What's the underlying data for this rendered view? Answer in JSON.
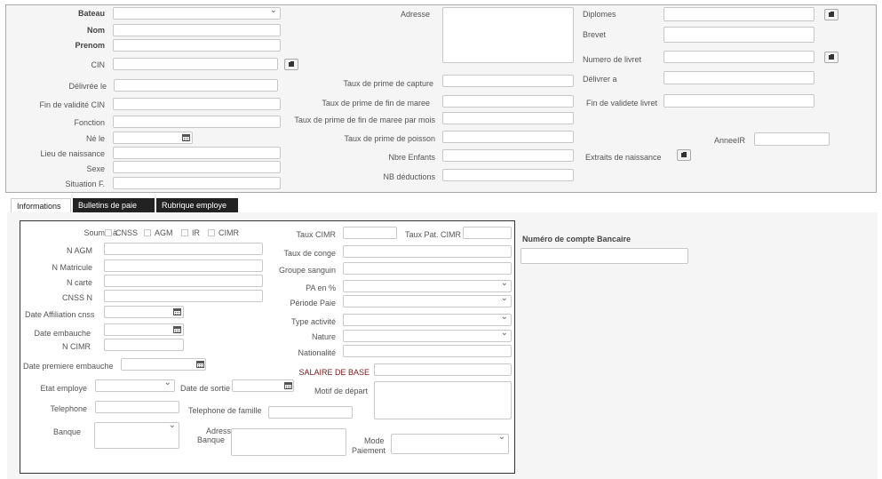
{
  "top": {
    "bateau": "Bateau",
    "nom": "Nom",
    "prenom": "Prenom",
    "cin": "CIN",
    "delivree_le": "Délivrée le",
    "fin_validite_cin": "Fin de validité CIN",
    "fonction": "Fonction",
    "ne_le": "Né le",
    "lieu_naissance": "Lieu de naissance",
    "sexe": "Sexe",
    "situation": "Situation F.",
    "adresse": "Adresse",
    "taux_capture": "Taux de prime de capture",
    "taux_fin_maree": "Taux de prime de fin de maree",
    "taux_fin_maree_mois": "Taux de prime de fin de maree par mois",
    "taux_poisson": "Taux de prime de poisson",
    "nbre_enfants": "Nbre Enfants",
    "nb_deductions": "NB déductions",
    "diplomes": "Diplomes",
    "brevet": "Brevet",
    "numero_livret": "Numero de livret",
    "delivrer_a": "Délivrer a",
    "fin_validite_livret": "Fin de validete livret",
    "annee_ir": "AnneeIR",
    "extraits_naissance": "Extraits de naissance"
  },
  "tabs": [
    {
      "label": "Informations"
    },
    {
      "label": "Bulletins de paie"
    },
    {
      "label": "Rubrique employe"
    }
  ],
  "info": {
    "soumis_a": "Soumis à",
    "cnss": "CNSS",
    "agm": "AGM",
    "ir": "IR",
    "cimr": "CIMR",
    "n_agm": "N AGM",
    "n_matricule": "N Matricule",
    "n_carte": "N carte",
    "cnss_n": "CNSS N",
    "date_affiliation": "Date Affiliation cnss",
    "date_embauche": "Date embauche",
    "n_cimr": "N CIMR",
    "date_premiere_embauche": "Date premiere embauche",
    "etat_employe": "Etat employe",
    "date_sortie": "Date de sortie",
    "telephone": "Telephone",
    "telephone_famille": "Telephone de famille",
    "banque": "Banque",
    "adresse_banque_1": "Adresse",
    "adresse_banque_2": "Banque",
    "mode_paiement_1": "Mode",
    "mode_paiement_2": "Paiement",
    "taux_cimr": "Taux CIMR",
    "taux_pat_cimr": "Taux Pat. CIMR",
    "taux_conge": "Taux de conge",
    "groupe_sanguin": "Groupe sanguin",
    "pa_en": "PA en %",
    "periode_paie": "Période Paie",
    "type_activite": "Type activité",
    "nature": "Nature",
    "nationalite": "Nationalité",
    "salaire_base": "SALAIRE DE BASE",
    "motif_depart": "Motif de départ"
  },
  "bank": {
    "numero_compte": "Numéro de compte Bancaire"
  }
}
